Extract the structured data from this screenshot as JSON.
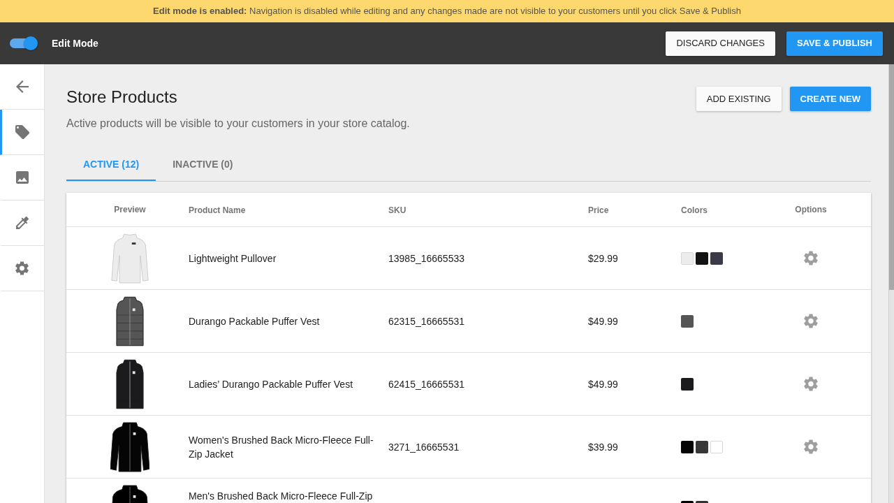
{
  "banner": {
    "text": "**Edit mode is enabled:** Navigation is disabled while editing and any changes made are not visible to your customers until you click Save & Publish"
  },
  "toolbar": {
    "edit_mode": {
      "label": "Edit Mode",
      "on": true
    },
    "buttons": [
      {
        "label": "DISCARD CHANGES",
        "kind": "secondary"
      },
      {
        "label": "SAVE & PUBLISH",
        "kind": "primary"
      }
    ]
  },
  "sidebar": {
    "items": [
      {
        "kind": "back",
        "selected": false
      },
      {
        "kind": "tag",
        "selected": true
      },
      {
        "kind": "image",
        "selected": false
      },
      {
        "kind": "eyedropper",
        "selected": false
      },
      {
        "kind": "gear",
        "selected": false
      }
    ]
  },
  "page": {
    "title": "Store Products",
    "subtitle": "Active products will be visible to your customers in your store catalog.",
    "buttons": [
      {
        "label": "ADD EXISTING",
        "kind": "secondary"
      },
      {
        "label": "CREATE NEW",
        "kind": "primary"
      }
    ]
  },
  "tabs": [
    {
      "label": "ACTIVE (12)",
      "selected": true
    },
    {
      "label": "INACTIVE (0)",
      "selected": false
    }
  ],
  "table": {
    "columns": [
      "Preview",
      "Product Name",
      "SKU",
      "Price",
      "Colors",
      "Options"
    ],
    "rows": [
      {
        "preview": {
          "kind": "pullover"
        },
        "name": "Lightweight Pullover",
        "sku": "13985_16665533",
        "price": "$29.99",
        "colors": [
          {
            "color": "#ececec"
          },
          {
            "color": "#131313"
          },
          {
            "color": "#3a3a48"
          }
        ],
        "cut_off": false
      },
      {
        "preview": {
          "kind": "vest"
        },
        "name": "Durango Packable Puffer Vest",
        "sku": "62315_16665531",
        "price": "$49.99",
        "colors": [
          {
            "color": "#555555"
          }
        ],
        "cut_off": false
      },
      {
        "preview": {
          "kind": "vest"
        },
        "name": "Ladies’ Durango Packable Puffer Vest",
        "sku": "62415_16665531",
        "price": "$49.99",
        "colors": [
          {
            "color": "#1b1a1c"
          }
        ],
        "cut_off": false
      },
      {
        "preview": {
          "kind": "jacket"
        },
        "name": "Women's Brushed Back Micro-Fleece Full-Zip Jacket",
        "sku": "3271_16665531",
        "price": "$39.99",
        "colors": [
          {
            "color": "#050505"
          },
          {
            "color": "#383838"
          },
          {
            "color": "#ffffff"
          }
        ],
        "cut_off": false
      },
      {
        "preview": {
          "kind": "jacket"
        },
        "name": "Men's Brushed Back Micro-Fleece Full-Zip",
        "colors": [
          {
            "color": "#000000"
          },
          {
            "color": "#333333"
          }
        ],
        "cut_off": true
      }
    ]
  }
}
